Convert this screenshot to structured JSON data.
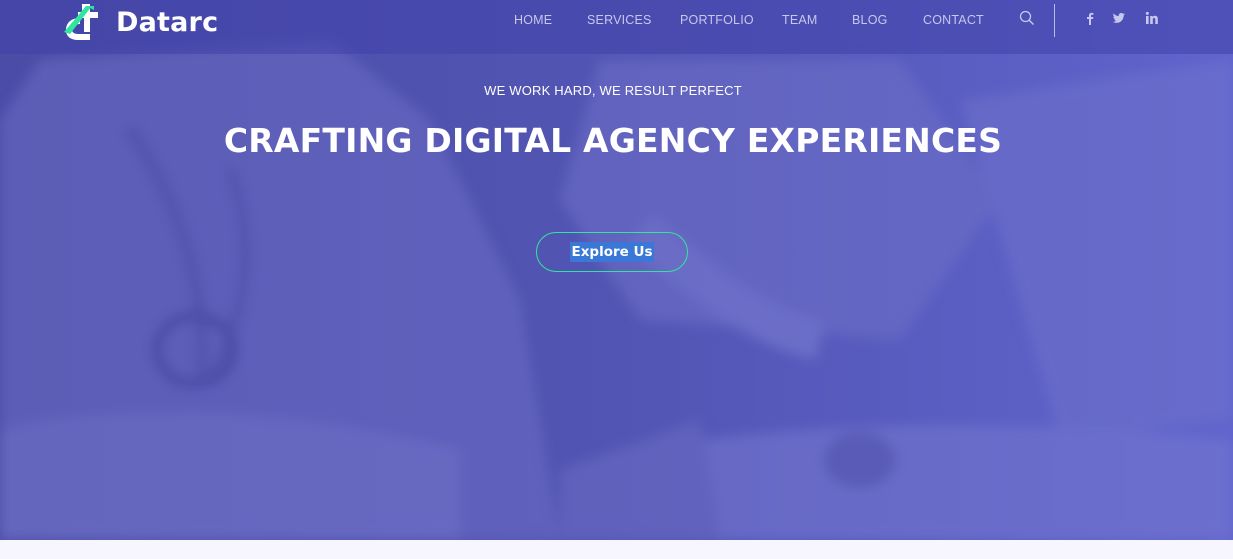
{
  "brand": {
    "name": "Datarc",
    "logo_icon": "datarc-logo-icon"
  },
  "nav": {
    "items": [
      {
        "label": "HOME"
      },
      {
        "label": "SERVICES"
      },
      {
        "label": "PORTFOLIO"
      },
      {
        "label": "TEAM"
      },
      {
        "label": "BLOG"
      },
      {
        "label": "CONTACT"
      }
    ],
    "search_icon": "search-icon",
    "social": [
      "facebook-icon",
      "twitter-icon",
      "linkedin-icon"
    ]
  },
  "hero": {
    "tagline": "WE WORK HARD, WE RESULT PERFECT",
    "headline": "CRAFTING DIGITAL AGENCY EXPERIENCES",
    "cta_label": "Explore Us"
  },
  "colors": {
    "overlay": "#5355b4",
    "accent": "#2ee6a0",
    "selection": "#3a78d8",
    "nav_text": "#c6c8ee"
  }
}
